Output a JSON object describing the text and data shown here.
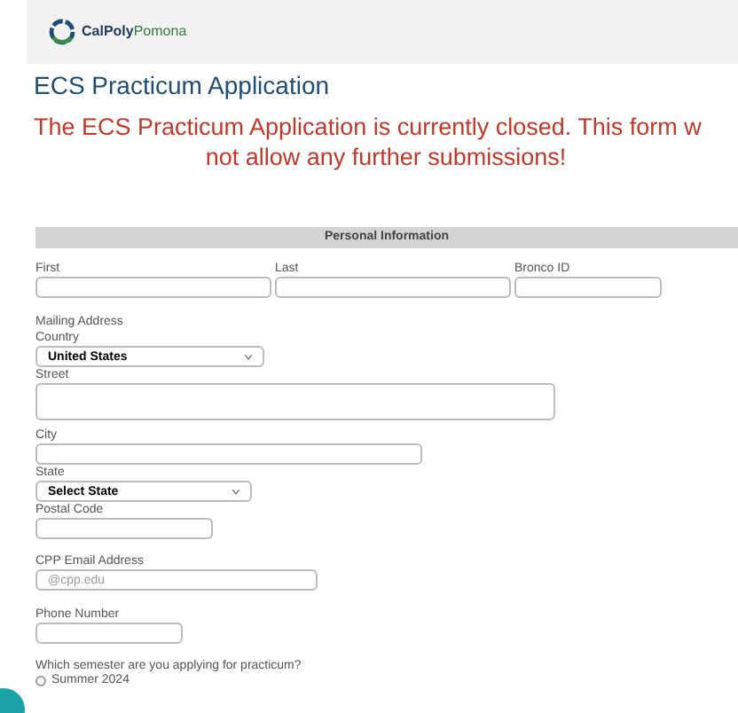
{
  "header": {
    "logo_text_bold": "CalPoly",
    "logo_text": "Pomona"
  },
  "title": "ECS Practicum Application",
  "notice": [
    "The ECS Practicum Application is currently closed. This form w",
    "not allow any further submissions!"
  ],
  "section": {
    "title": "Personal Information"
  },
  "name_fields": [
    {
      "label": "First"
    },
    {
      "label": "Last"
    },
    {
      "label": "Bronco ID"
    }
  ],
  "mailing_address": {
    "label": "Mailing Address",
    "fields": [
      {
        "kind": "select",
        "label": "Country",
        "value": "United States"
      },
      {
        "kind": "textarea",
        "label": "Street"
      },
      {
        "kind": "text",
        "label": "City"
      },
      {
        "kind": "select",
        "label": "State",
        "value": "Select State"
      },
      {
        "kind": "short",
        "label": "Postal Code"
      }
    ]
  },
  "email": {
    "label": "CPP Email Address",
    "placeholder": "@cpp.edu"
  },
  "phone": {
    "label": "Phone Number"
  },
  "semester": {
    "question": "Which semester are you applying for practicum?",
    "options": [
      {
        "label": "Summer 2024",
        "selected": false
      }
    ]
  }
}
